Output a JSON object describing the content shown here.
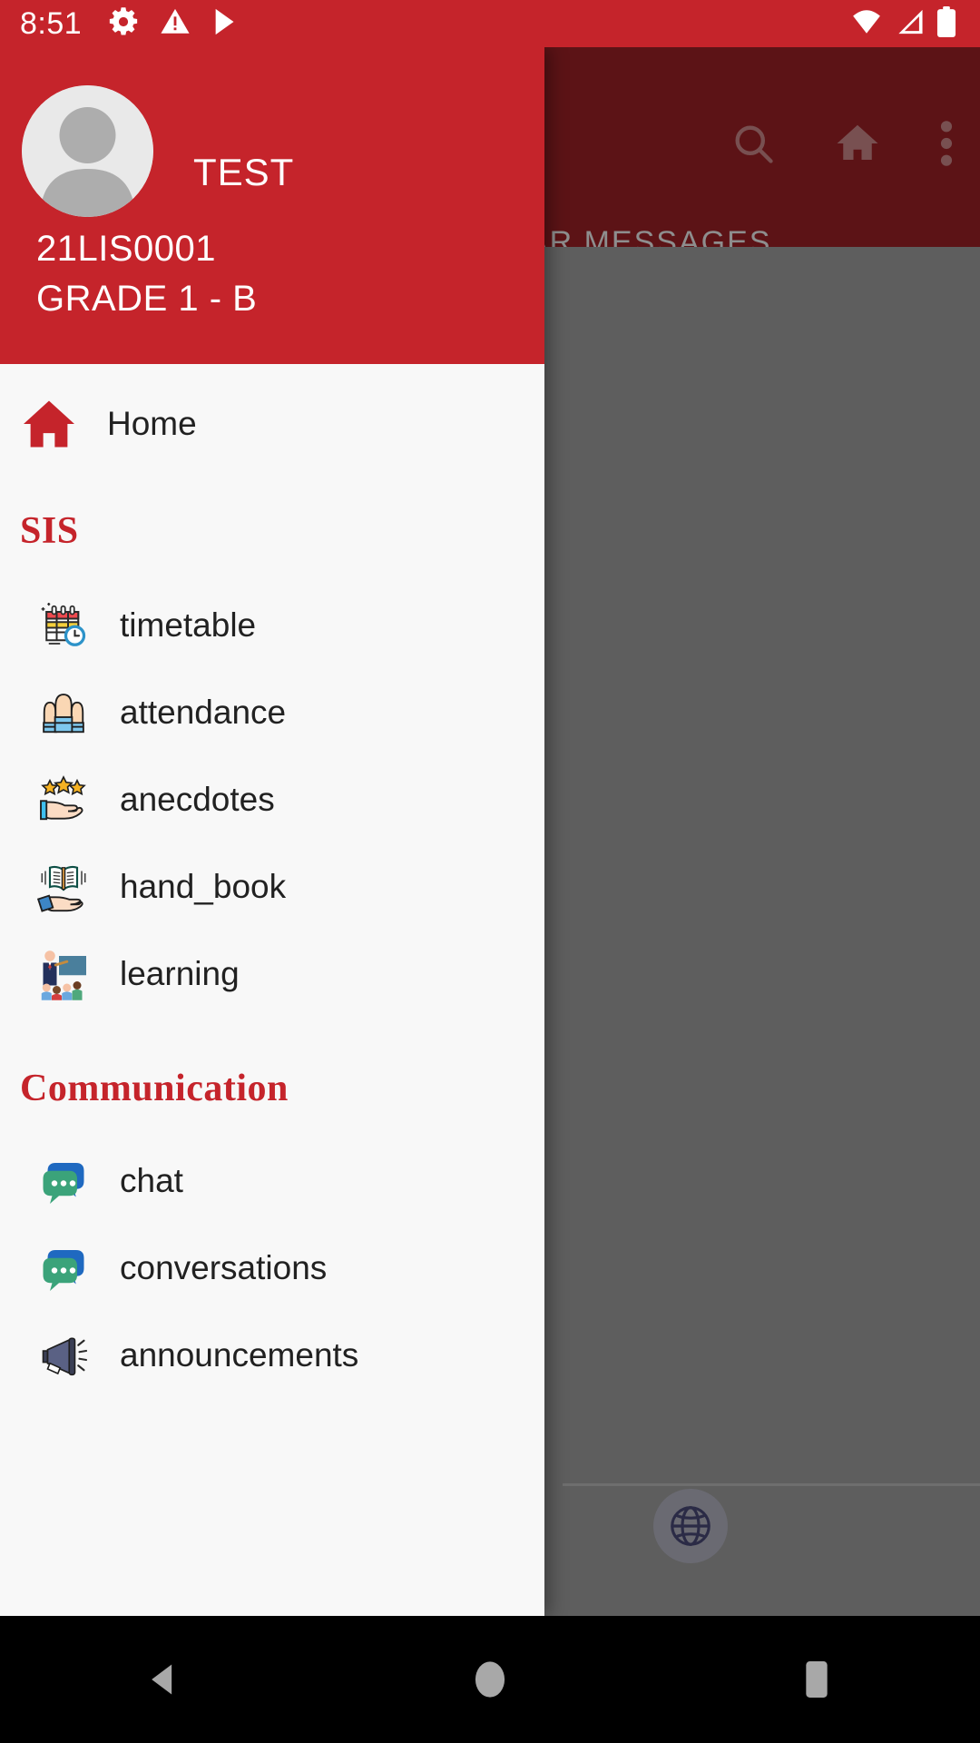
{
  "status_bar": {
    "time": "8:51",
    "left_icons": [
      "gear-icon",
      "warning-triangle-icon",
      "play-store-icon"
    ],
    "right_icons": [
      "wifi-icon",
      "cellular-signal-icon",
      "battery-icon"
    ],
    "background_color": "#c5242b"
  },
  "background_app": {
    "appbar_color": "#5c1316",
    "tab_label": "LAR MESSAGES",
    "actions": [
      {
        "name": "search-icon",
        "label": "Search"
      },
      {
        "name": "home-icon",
        "label": "Home"
      },
      {
        "name": "overflow-menu-icon",
        "label": "More options"
      }
    ],
    "fab": {
      "name": "globe-icon",
      "label": "Language"
    },
    "scrim_color": "#5e5e5e"
  },
  "drawer": {
    "header": {
      "avatar": "default-user-avatar",
      "name": "TEST",
      "id": "21LIS0001",
      "grade": "GRADE 1 - B",
      "background_color": "#c5242b"
    },
    "home": {
      "icon": "house-icon",
      "label": "Home"
    },
    "sections": [
      {
        "title": "SIS",
        "items": [
          {
            "icon": "calendar-clock-icon",
            "label": "timetable"
          },
          {
            "icon": "raised-hands-icon",
            "label": "attendance"
          },
          {
            "icon": "hand-stars-icon",
            "label": "anecdotes"
          },
          {
            "icon": "open-book-hand-icon",
            "label": "hand_book"
          },
          {
            "icon": "teacher-board-icon",
            "label": "learning"
          }
        ]
      },
      {
        "title": "Communication",
        "items": [
          {
            "icon": "chat-bubbles-icon",
            "label": "chat"
          },
          {
            "icon": "chat-bubbles-icon",
            "label": "conversations"
          },
          {
            "icon": "megaphone-icon",
            "label": "announcements"
          }
        ]
      }
    ],
    "accent_color": "#c5242b",
    "background_color": "#f8f8f8"
  },
  "system_nav": {
    "back": "back-button",
    "home": "home-button",
    "recents": "recents-button"
  }
}
